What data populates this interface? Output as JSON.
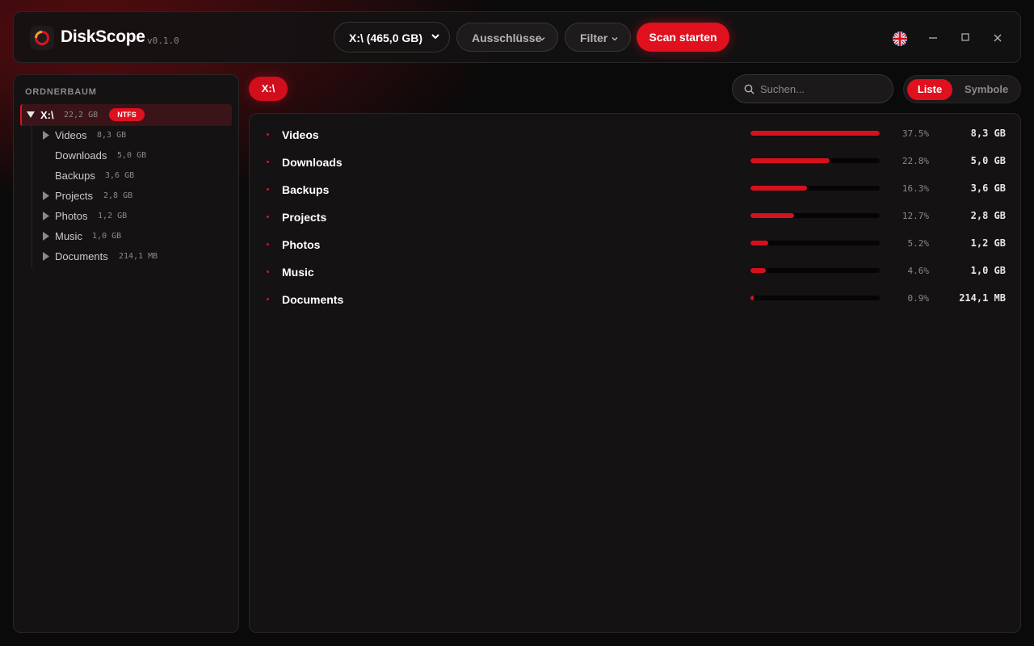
{
  "header": {
    "app_title": "DiskScope",
    "version": "v0.1.0",
    "drive_select": "X:\\ (465,0 GB)",
    "exclusions_label": "Ausschlüsse",
    "filter_label": "Filter",
    "scan_label": "Scan starten"
  },
  "sidebar": {
    "title": "ORDNERBAUM",
    "root": {
      "name": "X:\\",
      "size": "22,2 GB",
      "badge": "NTFS"
    },
    "items": [
      {
        "name": "Videos",
        "size": "8,3 GB",
        "expandable": true
      },
      {
        "name": "Downloads",
        "size": "5,0 GB",
        "expandable": false
      },
      {
        "name": "Backups",
        "size": "3,6 GB",
        "expandable": false
      },
      {
        "name": "Projects",
        "size": "2,8 GB",
        "expandable": true
      },
      {
        "name": "Photos",
        "size": "1,2 GB",
        "expandable": true
      },
      {
        "name": "Music",
        "size": "1,0 GB",
        "expandable": true
      },
      {
        "name": "Documents",
        "size": "214,1 MB",
        "expandable": true
      }
    ]
  },
  "content": {
    "breadcrumb": "X:\\",
    "search_placeholder": "Suchen...",
    "view_list": "Liste",
    "view_icons": "Symbole",
    "rows": [
      {
        "name": "Videos",
        "percent": "37.5%",
        "fraction": 1.0,
        "size": "8,3 GB"
      },
      {
        "name": "Downloads",
        "percent": "22.8%",
        "fraction": 0.61,
        "size": "5,0 GB"
      },
      {
        "name": "Backups",
        "percent": "16.3%",
        "fraction": 0.44,
        "size": "3,6 GB"
      },
      {
        "name": "Projects",
        "percent": "12.7%",
        "fraction": 0.34,
        "size": "2,8 GB"
      },
      {
        "name": "Photos",
        "percent": "5.2%",
        "fraction": 0.14,
        "size": "1,2 GB"
      },
      {
        "name": "Music",
        "percent": "4.6%",
        "fraction": 0.12,
        "size": "1,0 GB"
      },
      {
        "name": "Documents",
        "percent": "0.9%",
        "fraction": 0.025,
        "size": "214,1 MB"
      }
    ]
  },
  "colors": {
    "accent": "#e0101e",
    "background": "#0b0a0a",
    "panel": "#141212"
  }
}
